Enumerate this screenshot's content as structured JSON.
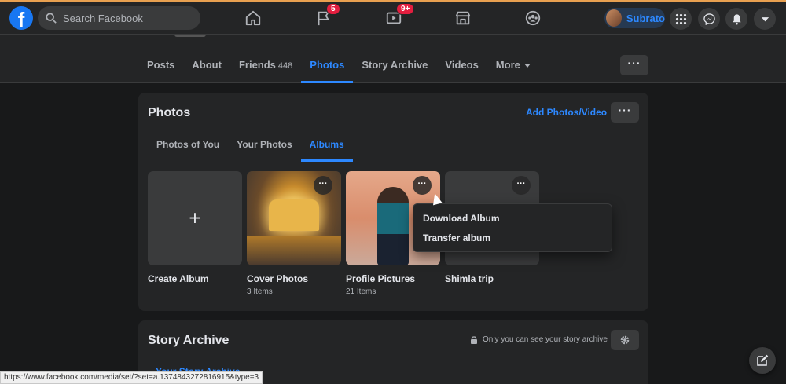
{
  "topbar": {
    "logo_letter": "f",
    "search_placeholder": "Search Facebook",
    "notifications": {
      "pages_badge": "5",
      "watch_badge": "9+"
    },
    "profile_name": "Subrato"
  },
  "profile_tabs": [
    {
      "label": "Posts"
    },
    {
      "label": "About"
    },
    {
      "label": "Friends",
      "count": "448"
    },
    {
      "label": "Photos",
      "active": true
    },
    {
      "label": "Story Archive"
    },
    {
      "label": "Videos"
    },
    {
      "label": "More"
    }
  ],
  "more_options_label": "···",
  "photos_card": {
    "title": "Photos",
    "add_label": "Add Photos/Video",
    "options_label": "···",
    "subtabs": [
      "Photos of You",
      "Your Photos",
      "Albums"
    ],
    "active_subtab": "Albums",
    "albums": [
      {
        "name": "Create Album",
        "count": ""
      },
      {
        "name": "Cover Photos",
        "count": "3 Items"
      },
      {
        "name": "Profile Pictures",
        "count": "21 Items"
      },
      {
        "name": "Shimla trip",
        "count": ""
      }
    ],
    "thumb_options_label": "···",
    "album_menu": [
      "Download Album",
      "Transfer album"
    ]
  },
  "story_card": {
    "title": "Story Archive",
    "privacy_text": "Only you can see your story archive",
    "subtab": "Your Story Archive"
  },
  "status_url": "https://www.facebook.com/media/set/?set=a.1374843272816915&type=3",
  "colors": {
    "accent": "#2d88ff",
    "background": "#18191a",
    "surface": "#242526",
    "badge": "#e41e3f"
  }
}
